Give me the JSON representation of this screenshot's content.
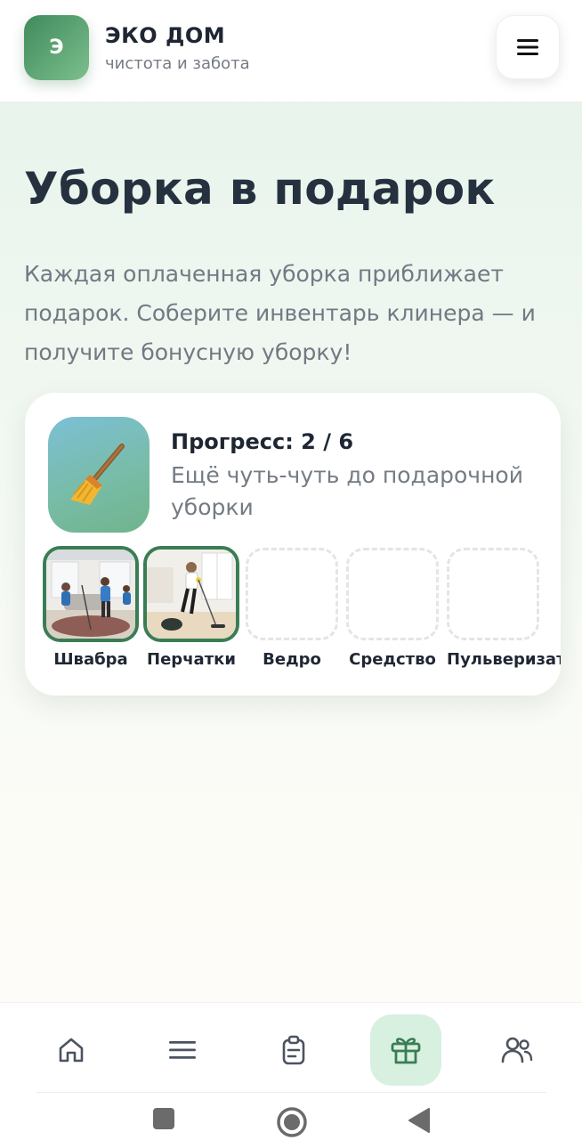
{
  "header": {
    "logo_letter": "Э",
    "brand_name": "ЭКО ДОМ",
    "tagline": "чистота и забота",
    "menu_icon": "hamburger-menu-icon"
  },
  "hero": {
    "title": "Уборка в подарок",
    "text": "Каждая оплаченная уборка приближает подарок. Соберите инвентарь клинера — и получите бонусную уборку!"
  },
  "progress_card": {
    "icon": "broom-icon",
    "title": "Прогресс: 2 / 6",
    "subtitle": "Ещё чуть-чуть до подарочной уборки",
    "collected": 2,
    "total": 6,
    "items": [
      {
        "label": "Швабра",
        "filled": true
      },
      {
        "label": "Перчатки",
        "filled": true
      },
      {
        "label": "Ведро",
        "filled": false
      },
      {
        "label": "Средство",
        "filled": false
      },
      {
        "label": "Пульверизатор",
        "filled": false
      }
    ]
  },
  "bottom_nav": {
    "items": [
      {
        "icon": "home-icon",
        "active": false
      },
      {
        "icon": "list-icon",
        "active": false
      },
      {
        "icon": "clipboard-icon",
        "active": false
      },
      {
        "icon": "gift-icon",
        "active": true
      },
      {
        "icon": "users-icon",
        "active": false
      }
    ],
    "accent": "#3a7d55",
    "active_bg": "#d8f0df"
  },
  "system_bar": {
    "buttons": [
      "recents-icon",
      "home-circle-icon",
      "back-icon"
    ]
  }
}
